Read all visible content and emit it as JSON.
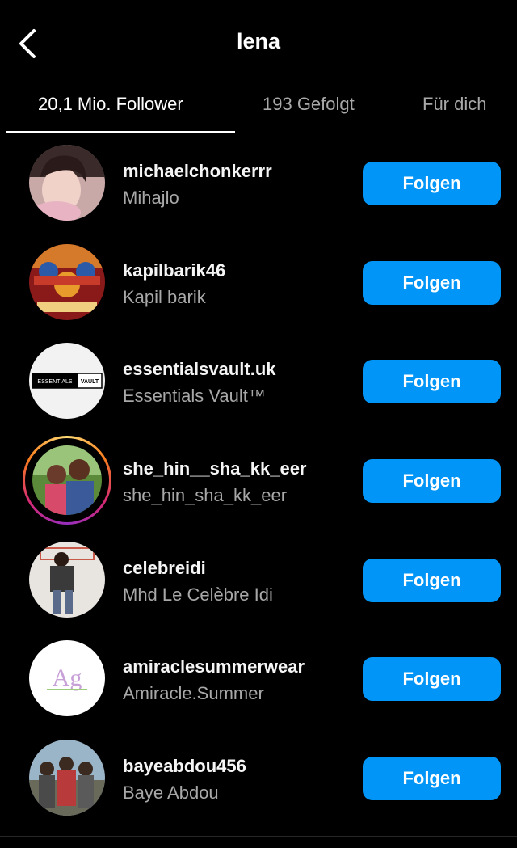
{
  "header": {
    "title": "lena",
    "back_icon": "chevron-left-icon"
  },
  "tabs": [
    {
      "label": "20,1 Mio. Follower",
      "active": true
    },
    {
      "label": "193 Gefolgt",
      "active": false
    },
    {
      "label": "Für dich",
      "active": false
    }
  ],
  "accounts": [
    {
      "username": "michaelchonkerrr",
      "full_name": "Mihajlo",
      "button_label": "Folgen"
    },
    {
      "username": "kapilbarik46",
      "full_name": "Kapil barik",
      "button_label": "Folgen"
    },
    {
      "username": "essentialsvault.uk",
      "full_name": "Essentials Vault™",
      "button_label": "Folgen",
      "logo_text_left": "ESSENTIALS",
      "logo_text_right": "VAULT"
    },
    {
      "username": "she_hin__sha_kk_eer",
      "full_name": "she_hin_sha_kk_eer",
      "button_label": "Folgen",
      "has_story": true
    },
    {
      "username": "celebreidi",
      "full_name": "Mhd Le Celèbre Idi",
      "button_label": "Folgen"
    },
    {
      "username": "amiraclesummerwear",
      "full_name": "Amiracle.Summer",
      "button_label": "Folgen",
      "logo_text": "Ag"
    },
    {
      "username": "bayeabdou456",
      "full_name": "Baye Abdou",
      "button_label": "Folgen"
    }
  ],
  "colors": {
    "background": "#000000",
    "follow_button": "#0095f6",
    "secondary_text": "#a8a8a8"
  }
}
